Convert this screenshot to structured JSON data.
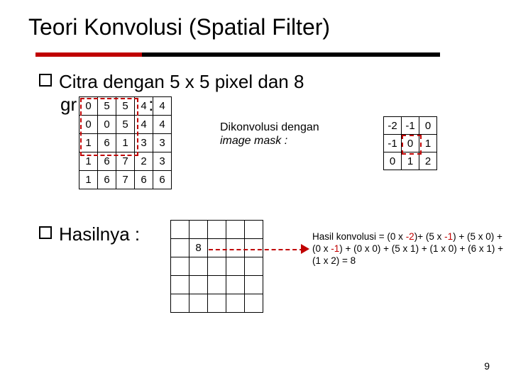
{
  "title": "Teori Konvolusi (Spatial Filter)",
  "bullet1_line1": "Citra dengan 5 x 5 pixel dan 8",
  "bullet1_line2_fragment": "gr              :",
  "source_grid": {
    "rows": [
      [
        "0",
        "5",
        "5",
        "4",
        "4"
      ],
      [
        "0",
        "0",
        "5",
        "4",
        "4"
      ],
      [
        "1",
        "6",
        "1",
        "3",
        "3"
      ],
      [
        "1",
        "6",
        "7",
        "2",
        "3"
      ],
      [
        "1",
        "6",
        "7",
        "6",
        "6"
      ]
    ]
  },
  "caption_line1": "Dikonvolusi dengan",
  "caption_line2": "image mask :",
  "mask": {
    "rows": [
      [
        "-2",
        "-1",
        "0"
      ],
      [
        "-1",
        "0",
        "1"
      ],
      [
        "0",
        "1",
        "2"
      ]
    ]
  },
  "bullet2": "Hasilnya :",
  "result_value": "8",
  "explain": {
    "prefix": "Hasil konvolusi = (0 x ",
    "neg2": "-2",
    "mid1": ")+ (5 x ",
    "neg1a": "-1",
    "mid2": ") + (5 x 0) + (0 x ",
    "neg1b": "-1",
    "mid3": ") + (0 x 0) + (5 x 1) + (1 x 0) + (6 x 1) + (1 x 2) = 8"
  },
  "page_number": "9"
}
